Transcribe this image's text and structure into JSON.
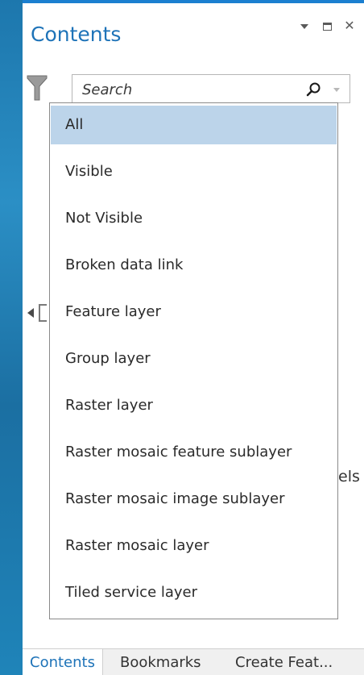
{
  "pane": {
    "title": "Contents"
  },
  "search": {
    "placeholder": "Search",
    "value": ""
  },
  "filter_dropdown": {
    "selected": "All",
    "options": [
      {
        "label": "All"
      },
      {
        "label": "Visible"
      },
      {
        "label": "Not Visible"
      },
      {
        "label": "Broken data link"
      },
      {
        "label": "Feature layer"
      },
      {
        "label": "Group layer"
      },
      {
        "label": "Raster layer"
      },
      {
        "label": "Raster mosaic feature sublayer"
      },
      {
        "label": "Raster mosaic image sublayer"
      },
      {
        "label": "Raster mosaic layer"
      },
      {
        "label": "Tiled service layer"
      }
    ]
  },
  "background": {
    "partial_text": "els"
  },
  "bottom_tabs": [
    {
      "label": "Contents"
    },
    {
      "label": "Bookmarks"
    },
    {
      "label": "Create Feat..."
    }
  ],
  "colors": {
    "accent": "#1e73b8",
    "selection": "#bcd4ea",
    "panel_border": "#1b7fd0"
  },
  "icons": {
    "filter": "funnel-icon",
    "search": "search-icon",
    "pin": "auto-hide-icon",
    "maximize": "maximize-icon",
    "close": "close-icon"
  }
}
